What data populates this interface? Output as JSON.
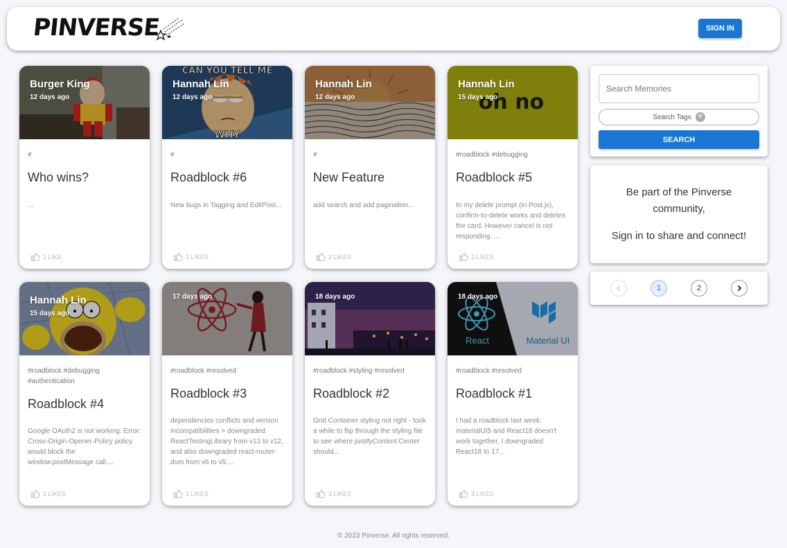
{
  "header": {
    "logo_text": "PINVERSE",
    "signin_label": "SIGN IN"
  },
  "posts": [
    {
      "author": "Burger King",
      "time": "12 days ago",
      "tags": "#",
      "title": "Who wins?",
      "message": "...",
      "likes": "1 LIKE"
    },
    {
      "author": "Hannah Lin",
      "time": "12 days ago",
      "tags": "#",
      "title": "Roadblock #6",
      "message": "New bugs in Tagging and EditPost...",
      "likes": "2 LIKES"
    },
    {
      "author": "Hannah Lin",
      "time": "12 days ago",
      "tags": "#",
      "title": "New Feature",
      "message": "add search and add pagination...",
      "likes": "2 LIKES"
    },
    {
      "author": "Hannah Lin",
      "time": "15 days ago",
      "tags": "#roadblock #debugging",
      "title": "Roadblock #5",
      "message": "In my delete prompt (in Post.js), confirm-to-delete works and deletes the card. However cancel is not responding. ...",
      "likes": "2 LIKES",
      "image_text": "oh no"
    },
    {
      "author": "Hannah Lin",
      "time": "15 days ago",
      "tags": "#roadblock #debugging #authentication",
      "title": "Roadblock #4",
      "message": "Google OAuth2 is not working. Error: Cross-Origin-Opener-Policy policy would block the window.postMessage call....",
      "likes": "2 LIKES"
    },
    {
      "author": "",
      "time": "17 days ago",
      "tags": "#roadblock #resolved",
      "title": "Roadblock #3",
      "message": "dependencies conflicts and version incompatibilities > downgraded ReactTestingLibrary from v13 to v12, and also downgraded react-router-dom from v6 to v5....",
      "likes": "3 LIKES"
    },
    {
      "author": "",
      "time": "18 days ago",
      "tags": "#roadblock #styling #resolved",
      "title": "Roadblock #2",
      "message": "Grid Container styling not right - took a while to flip through the styling file to see where justifyContent:Center should...",
      "likes": "3 LIKES"
    },
    {
      "author": "",
      "time": "18 days ago",
      "tags": "#roadblock #resolved",
      "title": "Roadblock #1",
      "message": "I had a roadblock last week: materialUI5 and React18 doesn't work together, I downgraded React18 to 17...",
      "likes": "3 LIKES",
      "image_text_left": "React",
      "image_text_right": "Material UI"
    }
  ],
  "meme_text": {
    "top": "CAN YOU TELL ME",
    "bottom": "WHY"
  },
  "search": {
    "placeholder": "Search Memories",
    "tags_chip": "Search Tags",
    "button_label": "SEARCH"
  },
  "join": {
    "line1": "Be part of the Pinverse",
    "line2": "community,",
    "line3": "Sign in to share and connect!"
  },
  "pagination": {
    "current": "1",
    "next_page": "2"
  },
  "footer": {
    "text": "© 2023 Pinverse. All rights reserved."
  },
  "colors": {
    "primary": "#1976d2",
    "background": "#f5f6fa"
  }
}
